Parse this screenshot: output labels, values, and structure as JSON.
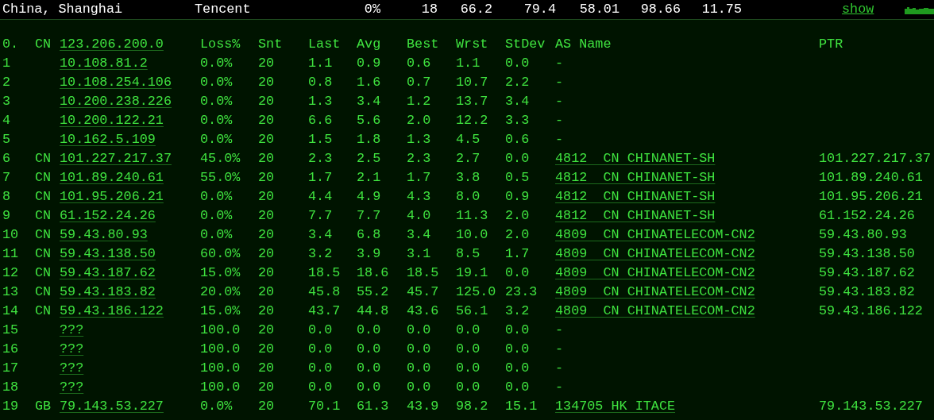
{
  "summary": {
    "location": "China, Shanghai",
    "provider": "Tencent",
    "cells": [
      "0%",
      "18",
      "66.2",
      "79.4",
      "58.01",
      "98.66",
      "11.75"
    ],
    "show_link": "show"
  },
  "origin": {
    "hop": "0.",
    "country": "CN",
    "ip": "123.206.200.0"
  },
  "columns": [
    "Loss%",
    "Snt",
    "Last",
    "Avg",
    "Best",
    "Wrst",
    "StDev",
    "AS Name",
    "PTR"
  ],
  "rows": [
    {
      "hop": "1",
      "ip": "10.108.81.2",
      "values": [
        "0.0%",
        "20",
        "1.1",
        "0.9",
        "0.6",
        "1.1",
        "0.0"
      ],
      "as_name": "-",
      "as_link": false
    },
    {
      "hop": "2",
      "ip": "10.108.254.106",
      "values": [
        "0.0%",
        "20",
        "0.8",
        "1.6",
        "0.7",
        "10.7",
        "2.2"
      ],
      "as_name": "-",
      "as_link": false
    },
    {
      "hop": "3",
      "ip": "10.200.238.226",
      "values": [
        "0.0%",
        "20",
        "1.3",
        "3.4",
        "1.2",
        "13.7",
        "3.4"
      ],
      "as_name": "-",
      "as_link": false
    },
    {
      "hop": "4",
      "ip": "10.200.122.21",
      "values": [
        "0.0%",
        "20",
        "6.6",
        "5.6",
        "2.0",
        "12.2",
        "3.3"
      ],
      "as_name": "-",
      "as_link": false
    },
    {
      "hop": "5",
      "ip": "10.162.5.109",
      "values": [
        "0.0%",
        "20",
        "1.5",
        "1.8",
        "1.3",
        "4.5",
        "0.6"
      ],
      "as_name": "-",
      "as_link": false
    },
    {
      "hop": "6",
      "country": "CN",
      "ip": "101.227.217.37",
      "values": [
        "45.0%",
        "20",
        "2.3",
        "2.5",
        "2.3",
        "2.7",
        "0.0"
      ],
      "as_name": "4812  CN CHINANET-SH",
      "as_link": true,
      "ptr": "101.227.217.37"
    },
    {
      "hop": "7",
      "country": "CN",
      "ip": "101.89.240.61",
      "values": [
        "55.0%",
        "20",
        "1.7",
        "2.1",
        "1.7",
        "3.8",
        "0.5"
      ],
      "as_name": "4812  CN CHINANET-SH",
      "as_link": true,
      "ptr": "101.89.240.61"
    },
    {
      "hop": "8",
      "country": "CN",
      "ip": "101.95.206.21",
      "values": [
        "0.0%",
        "20",
        "4.4",
        "4.9",
        "4.3",
        "8.0",
        "0.9"
      ],
      "as_name": "4812  CN CHINANET-SH",
      "as_link": true,
      "ptr": "101.95.206.21"
    },
    {
      "hop": "9",
      "country": "CN",
      "ip": "61.152.24.26",
      "values": [
        "0.0%",
        "20",
        "7.7",
        "7.7",
        "4.0",
        "11.3",
        "2.0"
      ],
      "as_name": "4812  CN CHINANET-SH",
      "as_link": true,
      "ptr": "61.152.24.26"
    },
    {
      "hop": "10",
      "country": "CN",
      "ip": "59.43.80.93",
      "values": [
        "0.0%",
        "20",
        "3.4",
        "6.8",
        "3.4",
        "10.0",
        "2.0"
      ],
      "as_name": "4809  CN CHINATELECOM-CN2",
      "as_link": true,
      "ptr": "59.43.80.93"
    },
    {
      "hop": "11",
      "country": "CN",
      "ip": "59.43.138.50",
      "values": [
        "60.0%",
        "20",
        "3.2",
        "3.9",
        "3.1",
        "8.5",
        "1.7"
      ],
      "as_name": "4809  CN CHINATELECOM-CN2",
      "as_link": true,
      "ptr": "59.43.138.50"
    },
    {
      "hop": "12",
      "country": "CN",
      "ip": "59.43.187.62",
      "values": [
        "15.0%",
        "20",
        "18.5",
        "18.6",
        "18.5",
        "19.1",
        "0.0"
      ],
      "as_name": "4809  CN CHINATELECOM-CN2",
      "as_link": true,
      "ptr": "59.43.187.62"
    },
    {
      "hop": "13",
      "country": "CN",
      "ip": "59.43.183.82",
      "values": [
        "20.0%",
        "20",
        "45.8",
        "55.2",
        "45.7",
        "125.0",
        "23.3"
      ],
      "as_name": "4809  CN CHINATELECOM-CN2",
      "as_link": true,
      "ptr": "59.43.183.82"
    },
    {
      "hop": "14",
      "country": "CN",
      "ip": "59.43.186.122",
      "values": [
        "15.0%",
        "20",
        "43.7",
        "44.8",
        "43.6",
        "56.1",
        "3.2"
      ],
      "as_name": "4809  CN CHINATELECOM-CN2",
      "as_link": true,
      "ptr": "59.43.186.122"
    },
    {
      "hop": "15",
      "ip": "???",
      "values": [
        "100.0",
        "20",
        "0.0",
        "0.0",
        "0.0",
        "0.0",
        "0.0"
      ],
      "as_name": "-",
      "as_link": false
    },
    {
      "hop": "16",
      "ip": "???",
      "values": [
        "100.0",
        "20",
        "0.0",
        "0.0",
        "0.0",
        "0.0",
        "0.0"
      ],
      "as_name": "-",
      "as_link": false
    },
    {
      "hop": "17",
      "ip": "???",
      "values": [
        "100.0",
        "20",
        "0.0",
        "0.0",
        "0.0",
        "0.0",
        "0.0"
      ],
      "as_name": "-",
      "as_link": false
    },
    {
      "hop": "18",
      "ip": "???",
      "values": [
        "100.0",
        "20",
        "0.0",
        "0.0",
        "0.0",
        "0.0",
        "0.0"
      ],
      "as_name": "-",
      "as_link": false
    },
    {
      "hop": "19",
      "country": "GB",
      "ip": "79.143.53.227",
      "values": [
        "0.0%",
        "20",
        "70.1",
        "61.3",
        "43.9",
        "98.2",
        "15.1"
      ],
      "as_name": "134705 HK ITACE",
      "as_link": true,
      "ptr": "79.143.53.227"
    }
  ]
}
